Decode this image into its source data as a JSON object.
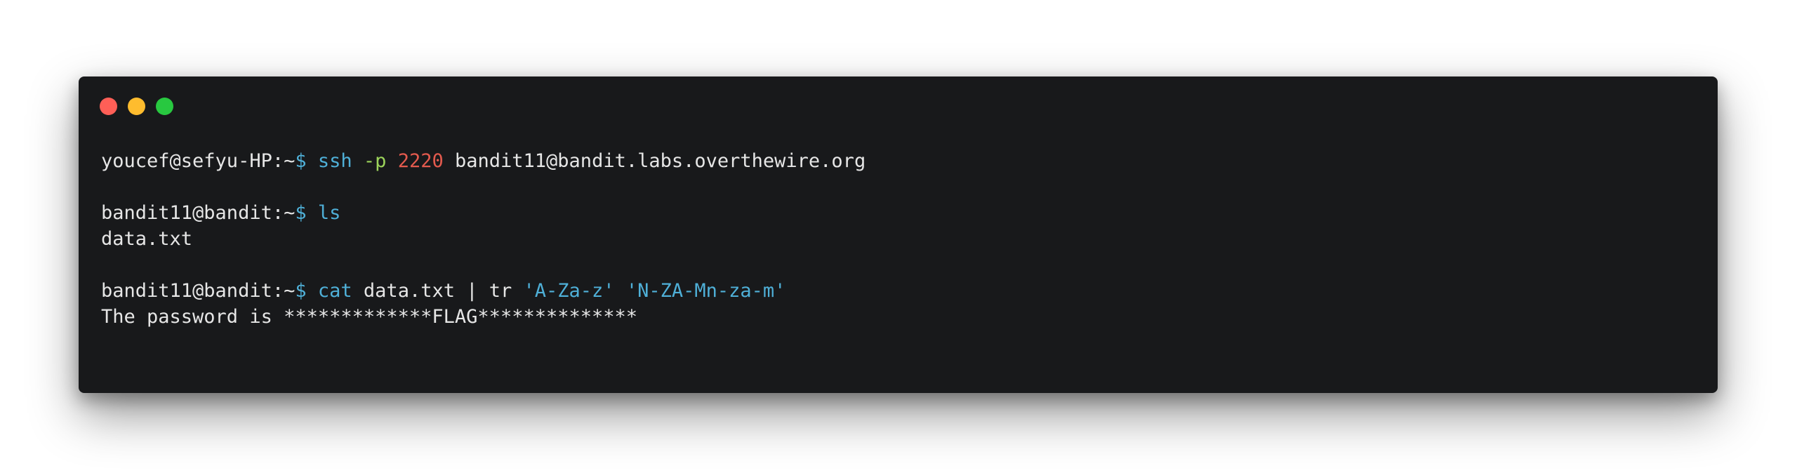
{
  "colors": {
    "close": "#ff5f57",
    "minimize": "#febc2e",
    "maximize": "#28c840",
    "background": "#18191b",
    "prompt_text": "#e6e6e6",
    "command": "#4fb0d8",
    "option": "#9cd45b",
    "number": "#e35a4e"
  },
  "window_controls": [
    {
      "name": "close-button",
      "icon": "red-dot-icon"
    },
    {
      "name": "minimize-button",
      "icon": "yellow-dot-icon"
    },
    {
      "name": "maximize-button",
      "icon": "green-dot-icon"
    }
  ],
  "terminal": {
    "line1": {
      "prompt": "youcef@sefyu-HP:~",
      "dollar": "$",
      "cmd": "ssh",
      "option": "-p",
      "port": "2220",
      "target": "bandit11@bandit.labs.overthewire.org"
    },
    "line2": {
      "prompt": "bandit11@bandit:~",
      "dollar": "$",
      "cmd": "ls"
    },
    "output1": "data.txt",
    "line3": {
      "prompt": "bandit11@bandit:~",
      "dollar": "$",
      "cmd": "cat",
      "args": "data.txt | tr",
      "set1": "'A-Za-z'",
      "set2": "'N-ZA-Mn-za-m'"
    },
    "output2": "The password is *************FLAG**************"
  }
}
